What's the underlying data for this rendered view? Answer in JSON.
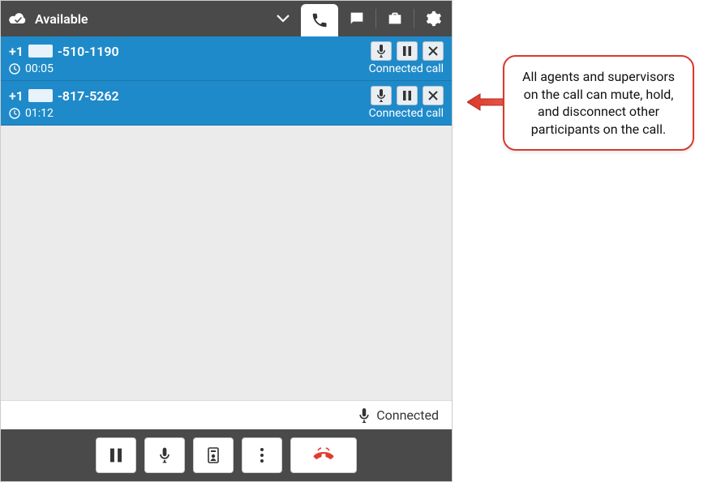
{
  "header": {
    "status": "Available"
  },
  "calls": [
    {
      "phone_prefix": "+1",
      "phone_suffix": "-510-1190",
      "duration": "00:05",
      "status": "Connected call"
    },
    {
      "phone_prefix": "+1",
      "phone_suffix": "-817-5262",
      "duration": "01:12",
      "status": "Connected call"
    }
  ],
  "footer": {
    "connected_label": "Connected"
  },
  "callout": {
    "text": "All agents and supervisors on the call can mute, hold, and disconnect other participants on the call."
  }
}
